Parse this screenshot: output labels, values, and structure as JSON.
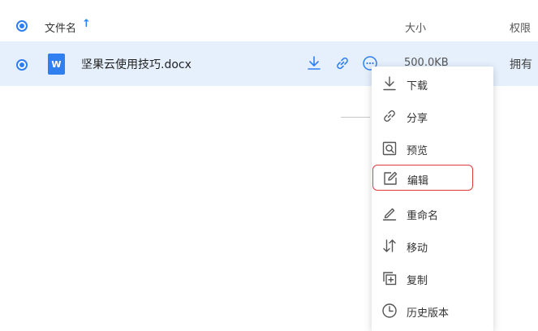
{
  "header": {
    "name_label": "文件名",
    "sort_arrow": "↑",
    "size_label": "大小",
    "perm_label": "权限"
  },
  "file": {
    "icon_letter": "W",
    "name": "坚果云使用技巧.docx",
    "size": "500.0KB",
    "permission": "拥有"
  },
  "menu": {
    "items": [
      {
        "label": "下载",
        "icon": "download-icon"
      },
      {
        "label": "分享",
        "icon": "link-icon"
      },
      {
        "label": "预览",
        "icon": "preview-icon"
      },
      {
        "label": "编辑",
        "icon": "edit-icon"
      },
      {
        "label": "重命名",
        "icon": "rename-icon"
      },
      {
        "label": "移动",
        "icon": "move-icon"
      },
      {
        "label": "复制",
        "icon": "copy-icon"
      },
      {
        "label": "历史版本",
        "icon": "history-icon"
      }
    ]
  },
  "colors": {
    "accent": "#2f7ff0",
    "row_bg": "#e6f0fd",
    "highlight_border": "#e03b3b"
  }
}
